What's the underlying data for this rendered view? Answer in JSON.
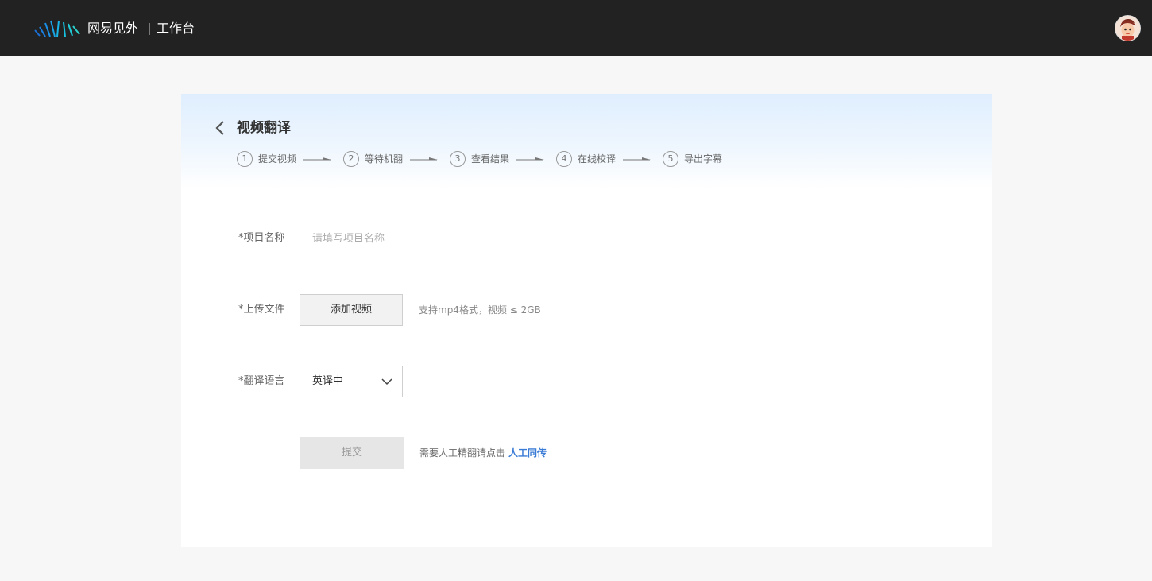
{
  "header": {
    "brand": "网易见外",
    "workspace": "工作台"
  },
  "page": {
    "title": "视频翻译",
    "steps": [
      {
        "number": "1",
        "label": "提交视频"
      },
      {
        "number": "2",
        "label": "等待机翻"
      },
      {
        "number": "3",
        "label": "查看结果"
      },
      {
        "number": "4",
        "label": "在线校译"
      },
      {
        "number": "5",
        "label": "导出字幕"
      }
    ]
  },
  "form": {
    "project_name": {
      "label": "*项目名称",
      "placeholder": "请填写项目名称",
      "value": ""
    },
    "upload": {
      "label": "*上传文件",
      "button": "添加视频",
      "hint": "支持mp4格式，视频 ≤ 2GB"
    },
    "language": {
      "label": "*翻译语言",
      "selected": "英译中"
    },
    "submit": {
      "label": "提交"
    },
    "manual": {
      "text": "需要人工精翻请点击",
      "link": "人工同传"
    }
  },
  "colors": {
    "topbar": "#222222",
    "page_bg": "#f7f7f7",
    "header_gradient_top": "#dfeefe",
    "link": "#3a7bd5",
    "logo_accent": "#1aa0e6"
  },
  "icons": {
    "logo": "waveform-logo-icon",
    "avatar": "user-avatar",
    "back": "chevron-left-icon",
    "step_arrow": "arrow-right-icon",
    "select": "chevron-down-icon"
  }
}
